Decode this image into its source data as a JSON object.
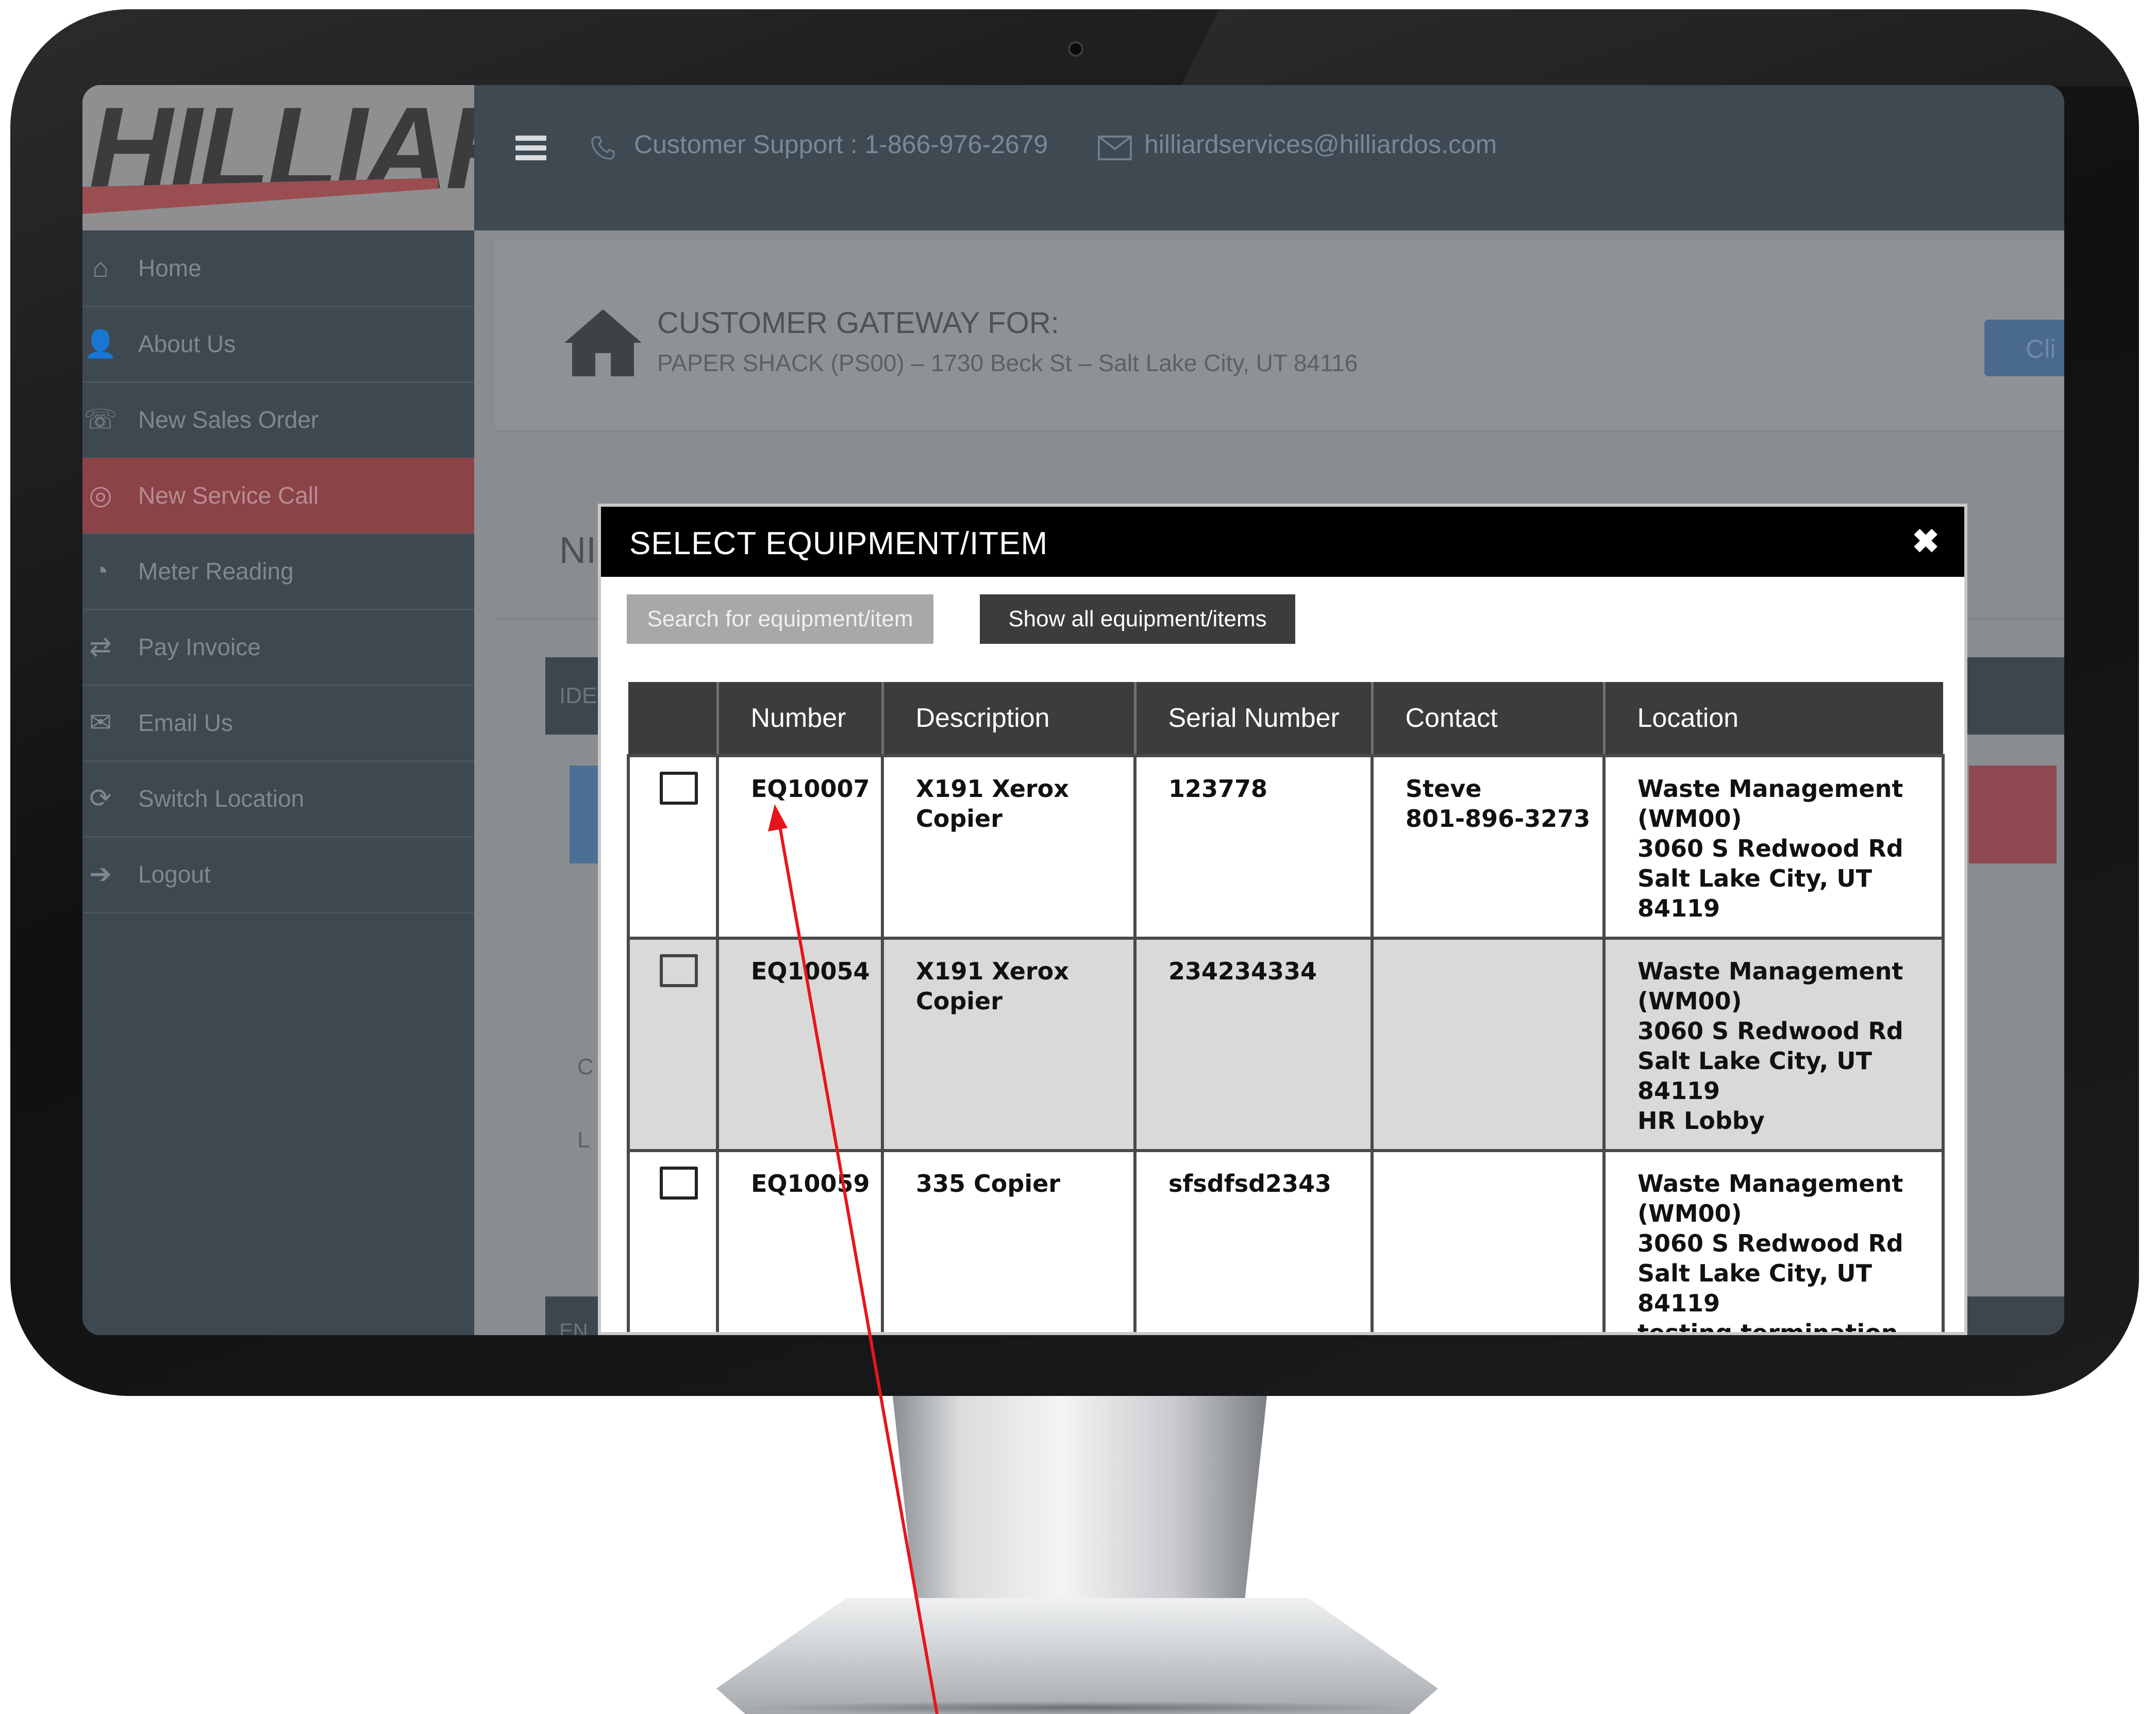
{
  "app": {
    "logo_text": "HILLIARD",
    "support_text": "Customer Support : 1-866-976-2679",
    "email_text": "hilliardservices@hilliardos.com"
  },
  "sidebar": {
    "items": [
      {
        "label": "Home",
        "icon": "home-icon"
      },
      {
        "label": "About Us",
        "icon": "user-icon"
      },
      {
        "label": "New Sales Order",
        "icon": "order-icon"
      },
      {
        "label": "New Service Call",
        "icon": "service-icon",
        "active": true
      },
      {
        "label": "Meter Reading",
        "icon": "meter-icon"
      },
      {
        "label": "Pay Invoice",
        "icon": "handshake-icon"
      },
      {
        "label": "Email Us",
        "icon": "envelope-icon"
      },
      {
        "label": "Switch Location",
        "icon": "switch-icon"
      },
      {
        "label": "Logout",
        "icon": "logout-icon"
      }
    ]
  },
  "gateway": {
    "title": "CUSTOMER GATEWAY FOR:",
    "subtitle": "PAPER SHACK (PS00) – 1730 Beck St – Salt Lake City, UT 84116",
    "client_button": "Cli",
    "partial_heading": "NI",
    "partial_bar": "IDE",
    "partial_c": "C",
    "partial_l": "L",
    "partial_en": "EN"
  },
  "modal": {
    "title": "SELECT EQUIPMENT/ITEM",
    "close_symbol": "✖",
    "search_button": "Search for equipment/item",
    "show_all_button": "Show all equipment/items",
    "columns": [
      "",
      "Number",
      "Description",
      "Serial Number",
      "Contact",
      "Location"
    ],
    "rows": [
      {
        "number": "EQ10007",
        "description": "X191 Xerox Copier",
        "serial": "123778",
        "contact": [
          "Steve",
          "801-896-3273"
        ],
        "location": [
          "Waste Management",
          "(WM00)",
          "3060 S Redwood Rd",
          "Salt Lake City, UT",
          "84119"
        ]
      },
      {
        "number": "EQ10054",
        "description": "X191 Xerox Copier",
        "serial": "234234334",
        "contact": [],
        "location": [
          "Waste Management",
          "(WM00)",
          "3060 S Redwood Rd",
          "Salt Lake City, UT",
          "84119",
          "HR Lobby"
        ]
      },
      {
        "number": "EQ10059",
        "description": "335 Copier",
        "serial": "sfsdfsd2343",
        "contact": [],
        "location": [
          "Waste Management",
          "(WM00)",
          "3060 S Redwood Rd",
          "Salt Lake City, UT",
          "84119",
          "testing termination"
        ]
      }
    ]
  },
  "colors": {
    "annotation_arrow": "#e8141b",
    "active_nav": "#8b4347",
    "modal_header": "#000000"
  }
}
